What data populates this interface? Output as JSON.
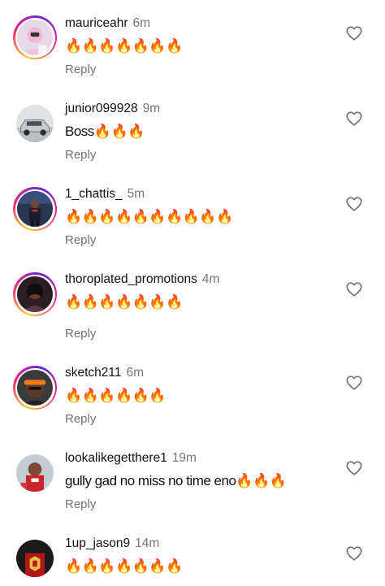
{
  "colors": {
    "text": "#111111",
    "secondary": "#767676",
    "reply": "#737373",
    "story_ring_start": "#f9ce34",
    "story_ring_mid": "#ee2a7b",
    "story_ring_end": "#6228d7"
  },
  "comments": [
    {
      "username": "mauriceahr",
      "time": "6m",
      "text": "🔥🔥🔥🔥🔥🔥🔥",
      "reply": "Reply",
      "like_icon": "heart-outline-icon"
    },
    {
      "username": "junior099928",
      "time": "9m",
      "text": "Boss🔥🔥🔥",
      "reply": "Reply",
      "like_icon": "heart-outline-icon"
    },
    {
      "username": "1_chattis_",
      "time": "5m",
      "text": "🔥🔥🔥🔥🔥🔥🔥🔥🔥🔥",
      "reply": "Reply",
      "like_icon": "heart-outline-icon"
    },
    {
      "username": "thoroplated_promotions",
      "time": "4m",
      "text": "🔥🔥🔥🔥🔥🔥🔥",
      "reply": "Reply",
      "like_icon": "heart-outline-icon"
    },
    {
      "username": "sketch211",
      "time": "6m",
      "text": "🔥🔥🔥🔥🔥🔥",
      "reply": "Reply",
      "like_icon": "heart-outline-icon"
    },
    {
      "username": "lookalikegetthere1",
      "time": "19m",
      "text": "gully gad  no miss no time eno🔥🔥🔥",
      "reply": "Reply",
      "like_icon": "heart-outline-icon"
    },
    {
      "username": "1up_jason9",
      "time": "14m",
      "text": "🔥🔥🔥🔥🔥🔥🔥",
      "reply": "",
      "like_icon": "heart-outline-icon"
    }
  ]
}
